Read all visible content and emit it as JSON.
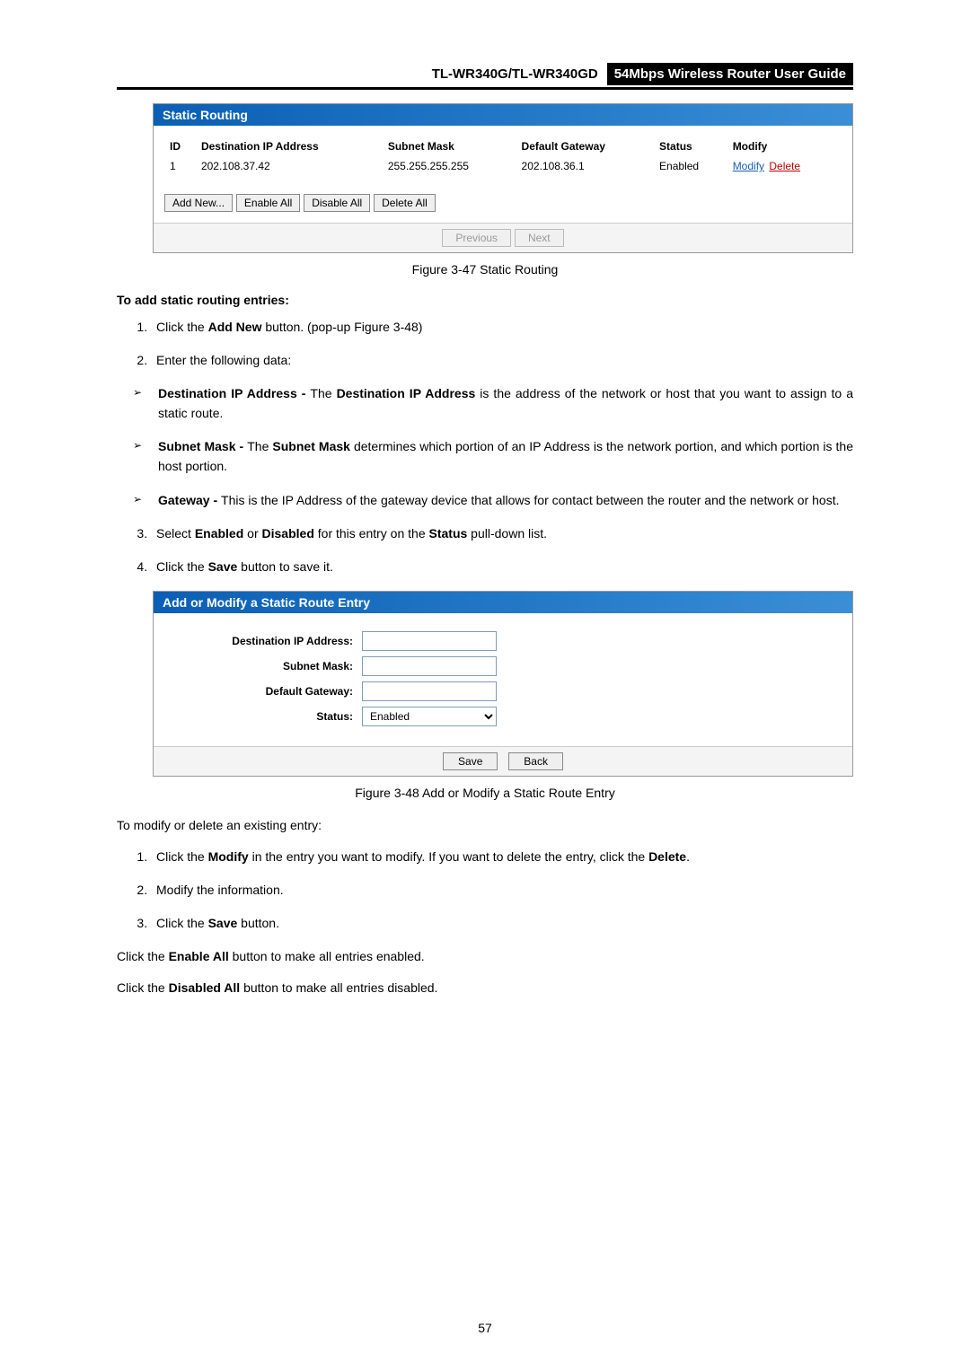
{
  "header": {
    "model": "TL-WR340G/TL-WR340GD",
    "title": "54Mbps Wireless Router User Guide"
  },
  "staticRouting": {
    "title": "Static Routing",
    "headers": {
      "id": "ID",
      "dest": "Destination IP Address",
      "mask": "Subnet Mask",
      "gateway": "Default Gateway",
      "status": "Status",
      "modify": "Modify"
    },
    "row": {
      "id": "1",
      "dest": "202.108.37.42",
      "mask": "255.255.255.255",
      "gateway": "202.108.36.1",
      "status": "Enabled",
      "modLink": "Modify",
      "delLink": "Delete"
    },
    "buttons": {
      "addNew": "Add New...",
      "enableAll": "Enable All",
      "disableAll": "Disable All",
      "deleteAll": "Delete All",
      "previous": "Previous",
      "next": "Next"
    }
  },
  "fig1": "Figure 3-47 Static Routing",
  "addHeading": "To add static routing entries:",
  "steps": {
    "s1a": "Click the ",
    "s1b": "Add New",
    "s1c": " button. (pop-up Figure 3-48)",
    "s2": "Enter the following data:",
    "s3a": "Select ",
    "s3b": "Enabled",
    "s3c": " or ",
    "s3d": "Disabled",
    "s3e": " for this entry on the ",
    "s3f": "Status",
    "s3g": " pull-down list.",
    "s4a": "Click the ",
    "s4b": "Save",
    "s4c": " button to save it."
  },
  "bullets": {
    "b1a": "Destination IP Address - ",
    "b1b": "The ",
    "b1c": "Destination IP Address",
    "b1d": " is the address of the network or host that you want to assign to a static route.",
    "b2a": "Subnet Mask - ",
    "b2b": "The ",
    "b2c": "Subnet Mask",
    "b2d": " determines which portion of an IP Address is the network portion, and which portion is the host portion.",
    "b3a": "Gateway - ",
    "b3b": "This is the IP Address of the gateway device that allows for contact between the router and the network or host."
  },
  "addModify": {
    "title": "Add or Modify a Static Route Entry",
    "labels": {
      "dest": "Destination IP Address:",
      "mask": "Subnet Mask:",
      "gateway": "Default Gateway:",
      "status": "Status:"
    },
    "statusValue": "Enabled",
    "save": "Save",
    "back": "Back"
  },
  "fig2": "Figure 3-48 Add or Modify a Static Route Entry",
  "modifyHeading": "To modify or delete an existing entry:",
  "modSteps": {
    "m1a": "Click the ",
    "m1b": "Modify",
    "m1c": " in the entry you want to modify. If you want to delete the entry, click the ",
    "m1d": "Delete",
    "m1e": ".",
    "m2": "Modify the information.",
    "m3a": "Click the ",
    "m3b": "Save",
    "m3c": " button."
  },
  "tail": {
    "t1a": "Click the ",
    "t1b": "Enable All",
    "t1c": " button to make all entries enabled.",
    "t2a": "Click the ",
    "t2b": "Disabled All",
    "t2c": " button to make all entries disabled."
  },
  "pageNum": "57"
}
